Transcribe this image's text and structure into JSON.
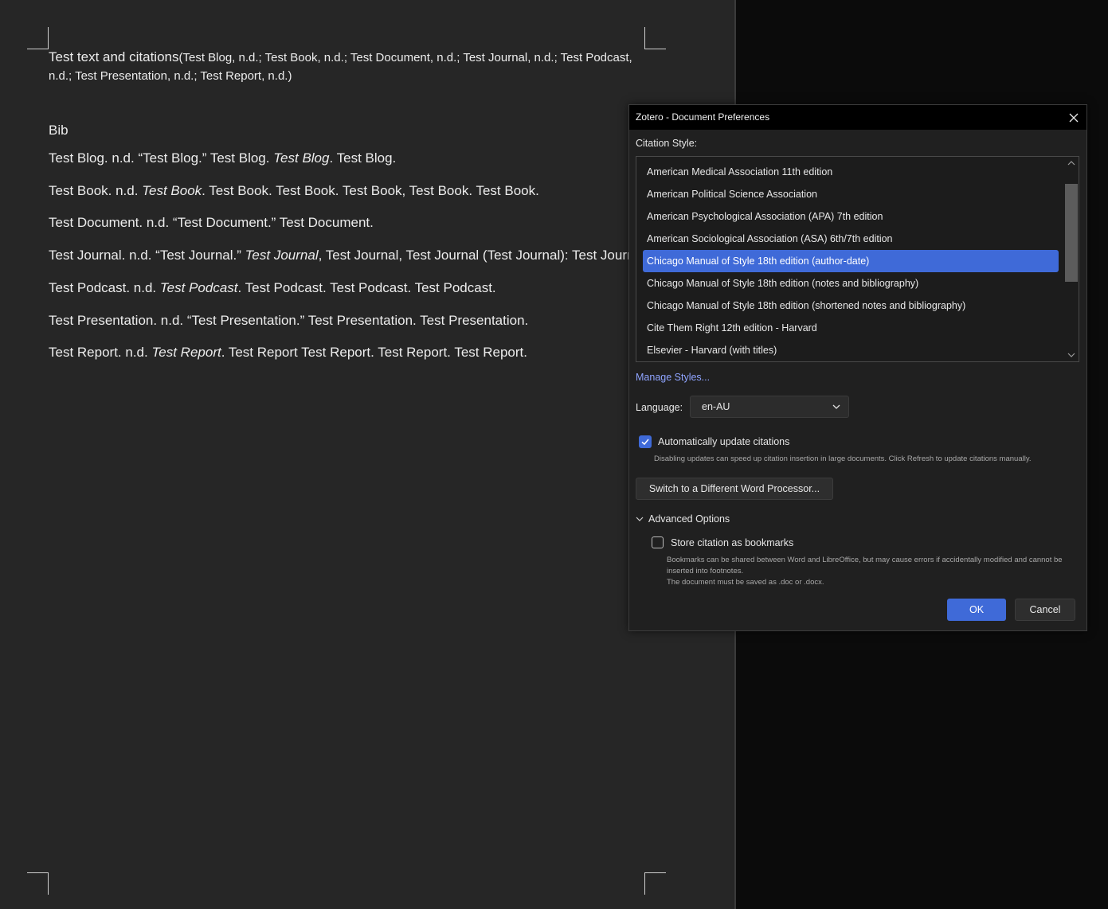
{
  "document": {
    "lead_text": "Test text and citations",
    "citation_text": "(Test Blog, n.d.; Test Book, n.d.; Test Document, n.d.; Test Journal, n.d.; Test Podcast, n.d.; Test Presentation, n.d.; Test Report, n.d.)",
    "bib_heading": "Bib",
    "bib_entries": [
      {
        "a": "Test Blog. n.d. “Test Blog.” Test Blog. ",
        "i": "Test Blog",
        "b": ". Test Blog."
      },
      {
        "a": "Test Book. n.d. ",
        "i": "Test Book",
        "b": ". Test Book. Test Book. Test Book, Test Book. Test Book."
      },
      {
        "a": "Test Document. n.d. “Test Document.” Test Document.",
        "i": "",
        "b": ""
      },
      {
        "a": "Test Journal. n.d. “Test Journal.” ",
        "i": "Test Journal",
        "b": ", Test Journal, Test Journal (Test Journal): Test Journal"
      },
      {
        "a": "Test Podcast. n.d. ",
        "i": "Test Podcast",
        "b": ". Test Podcast. Test Podcast. Test Podcast."
      },
      {
        "a": "Test Presentation. n.d. “Test Presentation.” Test Presentation. Test Presentation.",
        "i": "",
        "b": ""
      },
      {
        "a": "Test Report. n.d. ",
        "i": "Test Report",
        "b": ". Test Report Test Report. Test Report. Test Report."
      }
    ]
  },
  "dialog": {
    "title": "Zotero - Document Preferences",
    "citation_style_label": "Citation Style:",
    "styles": [
      "American Medical Association 11th edition",
      "American Political Science Association",
      "American Psychological Association (APA) 7th edition",
      "American Sociological Association (ASA) 6th/7th edition",
      "Chicago Manual of Style 18th edition (author-date)",
      "Chicago Manual of Style 18th edition (notes and bibliography)",
      "Chicago Manual of Style 18th edition (shortened notes and bibliography)",
      "Cite Them Right 12th edition - Harvard",
      "Elsevier - Harvard (with titles)"
    ],
    "selected_style": "Chicago Manual of Style 18th edition (author-date)",
    "manage_styles": "Manage Styles...",
    "language_label": "Language:",
    "language_value": "en-AU",
    "auto_update_label": "Automatically update citations",
    "auto_update_checked": true,
    "auto_update_desc": "Disabling updates can speed up citation insertion in large documents. Click Refresh to update citations manually.",
    "switch_button": "Switch to a Different Word Processor...",
    "advanced_label": "Advanced Options",
    "bookmarks_label": "Store citation as bookmarks",
    "bookmarks_checked": false,
    "bookmarks_desc_1": "Bookmarks can be shared between Word and LibreOffice, but may cause errors if accidentally modified and cannot be inserted into footnotes.",
    "bookmarks_desc_2": "The document must be saved as .doc or .docx.",
    "ok": "OK",
    "cancel": "Cancel"
  },
  "colors": {
    "accent": "#3f6ad8",
    "link": "#8fa4ff",
    "page_background": "#262626",
    "dialog_background": "#202020"
  },
  "icons": [
    "close-icon",
    "scroll-up-icon",
    "scroll-down-icon",
    "chevron-down-icon",
    "checkmark-icon",
    "chevron-down-icon"
  ]
}
